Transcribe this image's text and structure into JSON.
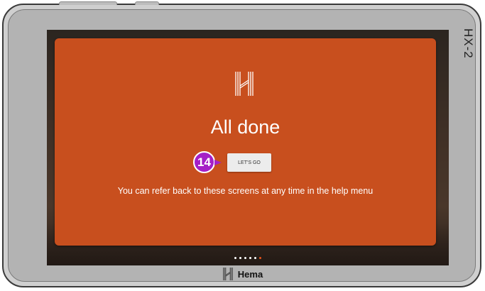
{
  "device": {
    "model": "HX-2",
    "brand_name": "Hema"
  },
  "card": {
    "title": "All done",
    "button_label": "LET'S GO",
    "help_text": "You can refer back to these screens at any time in the help menu",
    "color": "#c84f1e"
  },
  "annotation": {
    "step_number": "14",
    "color": "#a51fc6"
  },
  "pagination": {
    "total": 6,
    "active_index": 5,
    "active_color": "#e8531a"
  },
  "icons": [
    "hema-logo-icon"
  ]
}
